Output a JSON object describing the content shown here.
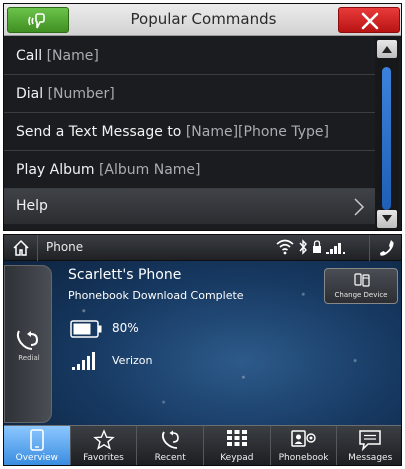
{
  "commands": {
    "title": "Popular Commands",
    "voice_icon": "voice-command-icon",
    "close_icon": "close-icon",
    "items": [
      {
        "command": "Call ",
        "param": "[Name]"
      },
      {
        "command": "Dial ",
        "param": "[Number]"
      },
      {
        "command": "Send a Text Message to ",
        "param": "[Name][Phone Type]"
      },
      {
        "command": "Play Album ",
        "param": "[Album Name]"
      },
      {
        "command": "Help",
        "param": ""
      }
    ]
  },
  "phone": {
    "title": "Phone",
    "device_name": "Scarlett's Phone",
    "phonebook_status": "Phonebook Download Complete",
    "battery": "80%",
    "carrier": "Verizon",
    "redial_label": "Redial",
    "change_device_label": "Change Device",
    "tabs": [
      {
        "label": "Overview",
        "icon": "phone-overview-icon",
        "active": true
      },
      {
        "label": "Favorites",
        "icon": "star-icon",
        "active": false
      },
      {
        "label": "Recent",
        "icon": "recent-calls-icon",
        "active": false
      },
      {
        "label": "Keypad",
        "icon": "keypad-icon",
        "active": false
      },
      {
        "label": "Phonebook",
        "icon": "phonebook-icon",
        "active": false
      },
      {
        "label": "Messages",
        "icon": "messages-icon",
        "active": false
      }
    ]
  },
  "colors": {
    "voice_green": "#4caf2c",
    "close_red": "#d42020",
    "scroll_blue": "#2d72cc",
    "active_tab_blue": "#5aa8f0"
  }
}
